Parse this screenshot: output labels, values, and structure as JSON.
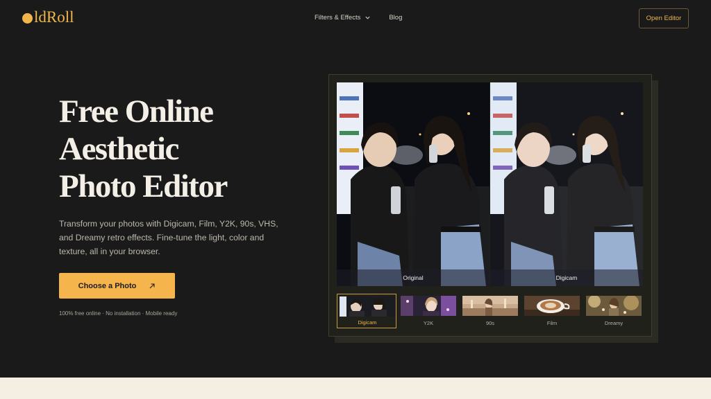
{
  "brand": {
    "logo_text": "ldRoll",
    "accent": "#f0b64b"
  },
  "nav": {
    "items": [
      {
        "label": "Filters & Effects",
        "has_dropdown": true,
        "icon": "chevron-down-icon"
      },
      {
        "label": "Blog",
        "has_dropdown": false
      }
    ],
    "open_editor": "Open Editor"
  },
  "hero": {
    "title_lines": [
      "Free Online",
      "Aesthetic",
      "Photo Editor"
    ],
    "description": "Transform your photos with Digicam, Film, Y2K, 90s, VHS, and Dreamy retro effects. Fine-tune the light, color and texture, all in your browser.",
    "cta_label": "Choose a Photo",
    "cta_icon": "arrow-up-right-icon",
    "cta_color": "#f6b44c",
    "tagline": "100% free online · No installation · Mobile ready"
  },
  "preview": {
    "left_label": "Original",
    "right_label": "Digicam",
    "filters": [
      {
        "label": "Digicam",
        "active": true
      },
      {
        "label": "Y2K",
        "active": false
      },
      {
        "label": "90s",
        "active": false
      },
      {
        "label": "Film",
        "active": false
      },
      {
        "label": "Dreamy",
        "active": false
      }
    ]
  }
}
